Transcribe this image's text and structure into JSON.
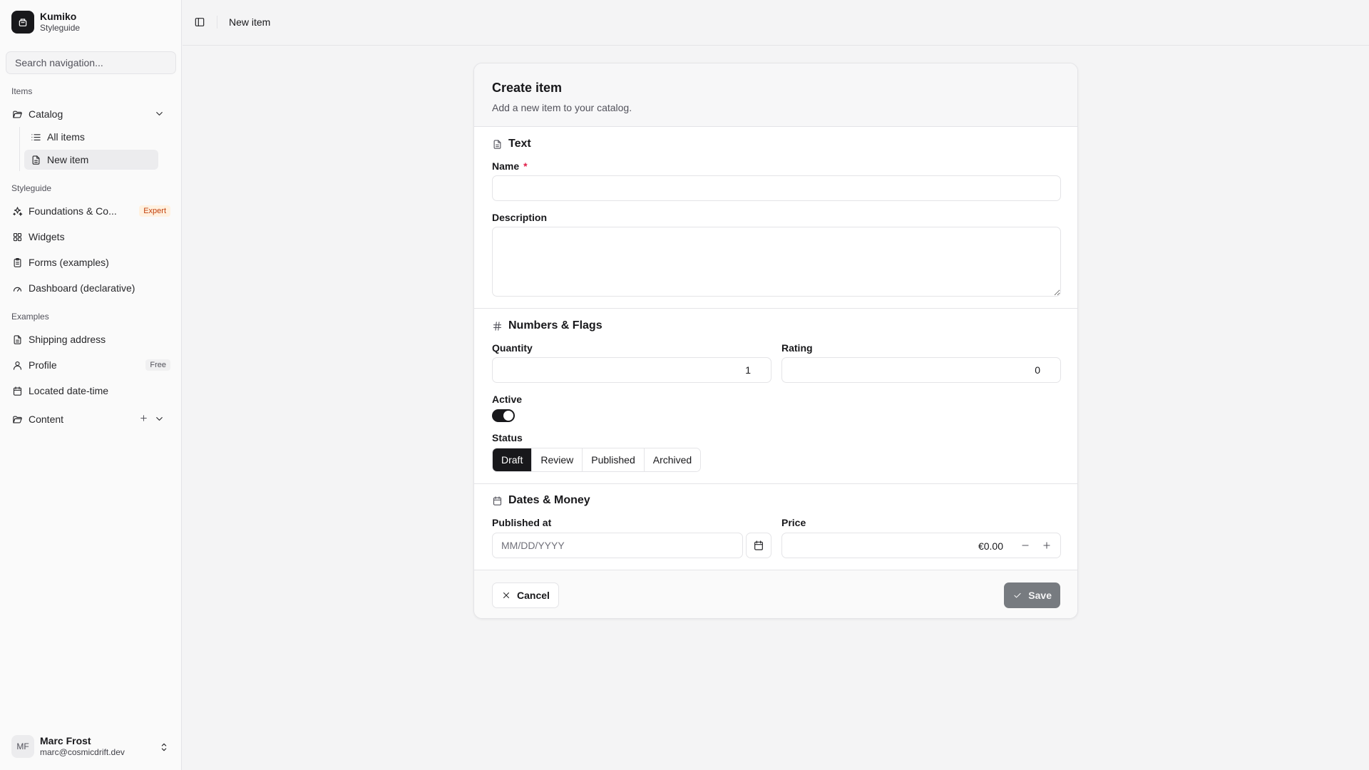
{
  "brand": {
    "name": "Kumiko",
    "subtitle": "Styleguide"
  },
  "search": {
    "placeholder": "Search navigation..."
  },
  "nav": {
    "groups": [
      "Items",
      "Styleguide",
      "Examples"
    ],
    "catalog": {
      "label": "Catalog",
      "icon": "folder-open-icon"
    },
    "catalog_items": [
      {
        "label": "All items",
        "icon": "list-icon"
      },
      {
        "label": "New item",
        "icon": "file-text-icon",
        "active": true
      }
    ],
    "styleguide_items": [
      {
        "label": "Foundations & Co...",
        "icon": "sparkles-icon",
        "badge": "Expert"
      },
      {
        "label": "Widgets",
        "icon": "grid-icon"
      },
      {
        "label": "Forms (examples)",
        "icon": "clipboard-icon"
      },
      {
        "label": "Dashboard (declarative)",
        "icon": "gauge-icon"
      }
    ],
    "example_items": [
      {
        "label": "Shipping address",
        "icon": "file-text-icon"
      },
      {
        "label": "Profile",
        "icon": "user-icon",
        "badge": "Free"
      },
      {
        "label": "Located date-time",
        "icon": "calendar-icon"
      }
    ],
    "content": {
      "label": "Content",
      "icon": "folder-open-icon"
    }
  },
  "user": {
    "initials": "MF",
    "name": "Marc Frost",
    "email": "marc@cosmicdrift.dev"
  },
  "header": {
    "title": "New item"
  },
  "form": {
    "title": "Create item",
    "description": "Add a new item to your catalog.",
    "sections": {
      "text": "Text",
      "numbers": "Numbers & Flags",
      "dates": "Dates & Money"
    },
    "fields": {
      "name_label": "Name",
      "required_mark": "*",
      "name_value": "",
      "description_label": "Description",
      "description_value": "",
      "quantity_label": "Quantity",
      "quantity_value": "1",
      "rating_label": "Rating",
      "rating_value": "0",
      "active_label": "Active",
      "active_value": true,
      "status_label": "Status",
      "status_options": [
        "Draft",
        "Review",
        "Published",
        "Archived"
      ],
      "status_selected": "Draft",
      "published_label": "Published at",
      "published_placeholder": "MM/DD/YYYY",
      "price_label": "Price",
      "price_value": "€0.00"
    },
    "actions": {
      "cancel": "Cancel",
      "save": "Save"
    }
  },
  "colors": {
    "primary": "#18181b",
    "accent_badge": "#c2410c",
    "required": "#e11d48",
    "save_disabled": "#71757a"
  }
}
